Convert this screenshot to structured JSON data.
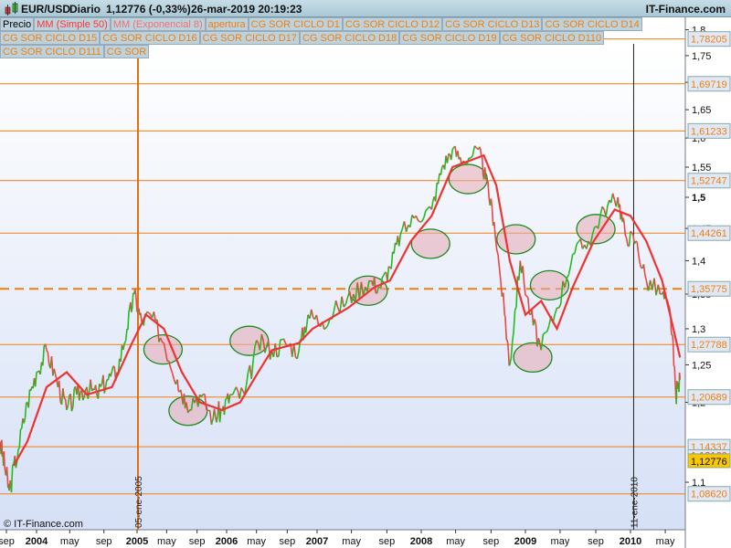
{
  "header": {
    "symbol": "EUR/USD",
    "period": "Diario",
    "price": "1,12776 (-0,33%)",
    "datetime": "26-mar-2019 20:19:23",
    "site": "IT-Finance.com"
  },
  "legend": [
    {
      "label": "Precio",
      "color": "#000000"
    },
    {
      "label": "MM (Simple 50)",
      "color": "#ff3333"
    },
    {
      "label": "MM (Exponencial 8)",
      "color": "#f07070"
    },
    {
      "label": "apertura",
      "color": "#f07f10"
    },
    {
      "label": "CG SOR CICLO D1",
      "color": "#f07f10"
    },
    {
      "label": "CG SOR CICLO D12",
      "color": "#f07f10"
    },
    {
      "label": "CG SOR CICLO D13",
      "color": "#f07f10"
    },
    {
      "label": "CG SOR CICLO D14",
      "color": "#f07f10"
    },
    {
      "label": "CG SOR CICLO D15",
      "color": "#f07f10"
    },
    {
      "label": "CG SOR CICLO D16",
      "color": "#f07f10"
    },
    {
      "label": "CG SOR CICLO D17",
      "color": "#f07f10"
    },
    {
      "label": "CG SOR CICLO D18",
      "color": "#f07f10"
    },
    {
      "label": "CG SOR CICLO D19",
      "color": "#f07f10"
    },
    {
      "label": "CG SOR CICLO D110",
      "color": "#f07f10"
    },
    {
      "label": "CG SOR CICLO D111",
      "color": "#f07f10"
    },
    {
      "label": "CG SOR",
      "color": "#f07f10"
    }
  ],
  "copyright": "© IT-Finance.com",
  "chart_data": {
    "type": "line",
    "yscale": "log",
    "ylim": [
      1.055,
      1.83
    ],
    "xlim": [
      2003.6,
      2010.65
    ],
    "y_ticks": [
      {
        "v": 1.1,
        "l": "1,1"
      },
      {
        "v": 1.2,
        "l": "1,2"
      },
      {
        "v": 1.25,
        "l": "1,25"
      },
      {
        "v": 1.3,
        "l": "1,3"
      },
      {
        "v": 1.35,
        "l": "1,35"
      },
      {
        "v": 1.4,
        "l": "1,4"
      },
      {
        "v": 1.45,
        "l": "1,45"
      },
      {
        "v": 1.5,
        "l": "1,5"
      },
      {
        "v": 1.55,
        "l": "1,55"
      },
      {
        "v": 1.6,
        "l": "1,6"
      },
      {
        "v": 1.65,
        "l": "1,65"
      },
      {
        "v": 1.7,
        "l": "1,7"
      },
      {
        "v": 1.75,
        "l": "1,75"
      },
      {
        "v": 1.8,
        "l": "1,8"
      }
    ],
    "x_ticks": [
      {
        "v": 2003.67,
        "l": "sep"
      },
      {
        "v": 2004.0,
        "l": "2004",
        "bold": true
      },
      {
        "v": 2004.33,
        "l": "may"
      },
      {
        "v": 2004.67,
        "l": "sep"
      },
      {
        "v": 2005.0,
        "l": "2005",
        "bold": true
      },
      {
        "v": 2005.33,
        "l": "may"
      },
      {
        "v": 2005.67,
        "l": "sep"
      },
      {
        "v": 2006.0,
        "l": "2006",
        "bold": true
      },
      {
        "v": 2006.33,
        "l": "may"
      },
      {
        "v": 2006.67,
        "l": "sep"
      },
      {
        "v": 2007.0,
        "l": "2007",
        "bold": true
      },
      {
        "v": 2007.33,
        "l": "may"
      },
      {
        "v": 2007.67,
        "l": "sep"
      },
      {
        "v": 2008.0,
        "l": "2008",
        "bold": true
      },
      {
        "v": 2008.33,
        "l": "may"
      },
      {
        "v": 2008.67,
        "l": "sep"
      },
      {
        "v": 2009.0,
        "l": "2009",
        "bold": true
      },
      {
        "v": 2009.33,
        "l": "may"
      },
      {
        "v": 2009.67,
        "l": "sep"
      },
      {
        "v": 2010.0,
        "l": "2010",
        "bold": true
      },
      {
        "v": 2010.33,
        "l": "may"
      }
    ],
    "price": [
      [
        2003.6,
        1.15
      ],
      [
        2003.65,
        1.12
      ],
      [
        2003.7,
        1.09
      ],
      [
        2003.8,
        1.14
      ],
      [
        2003.9,
        1.2
      ],
      [
        2004.0,
        1.24
      ],
      [
        2004.1,
        1.27
      ],
      [
        2004.2,
        1.23
      ],
      [
        2004.3,
        1.19
      ],
      [
        2004.4,
        1.21
      ],
      [
        2004.5,
        1.22
      ],
      [
        2004.6,
        1.21
      ],
      [
        2004.7,
        1.23
      ],
      [
        2004.8,
        1.24
      ],
      [
        2004.9,
        1.3
      ],
      [
        2004.97,
        1.35
      ],
      [
        2005.05,
        1.31
      ],
      [
        2005.15,
        1.32
      ],
      [
        2005.3,
        1.28
      ],
      [
        2005.45,
        1.23
      ],
      [
        2005.55,
        1.2
      ],
      [
        2005.7,
        1.21
      ],
      [
        2005.85,
        1.18
      ],
      [
        2005.95,
        1.19
      ],
      [
        2006.05,
        1.21
      ],
      [
        2006.2,
        1.21
      ],
      [
        2006.35,
        1.28
      ],
      [
        2006.5,
        1.27
      ],
      [
        2006.65,
        1.28
      ],
      [
        2006.8,
        1.27
      ],
      [
        2006.9,
        1.32
      ],
      [
        2007.05,
        1.31
      ],
      [
        2007.2,
        1.33
      ],
      [
        2007.35,
        1.35
      ],
      [
        2007.5,
        1.37
      ],
      [
        2007.6,
        1.36
      ],
      [
        2007.7,
        1.39
      ],
      [
        2007.8,
        1.44
      ],
      [
        2007.95,
        1.47
      ],
      [
        2008.1,
        1.48
      ],
      [
        2008.2,
        1.55
      ],
      [
        2008.3,
        1.58
      ],
      [
        2008.4,
        1.56
      ],
      [
        2008.55,
        1.58
      ],
      [
        2008.62,
        1.53
      ],
      [
        2008.7,
        1.46
      ],
      [
        2008.8,
        1.32
      ],
      [
        2008.85,
        1.25
      ],
      [
        2008.95,
        1.4
      ],
      [
        2009.05,
        1.32
      ],
      [
        2009.15,
        1.27
      ],
      [
        2009.3,
        1.33
      ],
      [
        2009.45,
        1.41
      ],
      [
        2009.6,
        1.43
      ],
      [
        2009.75,
        1.48
      ],
      [
        2009.88,
        1.5
      ],
      [
        2009.95,
        1.44
      ],
      [
        2010.05,
        1.43
      ],
      [
        2010.15,
        1.37
      ],
      [
        2010.3,
        1.35
      ],
      [
        2010.38,
        1.32
      ],
      [
        2010.43,
        1.21
      ],
      [
        2010.47,
        1.23
      ]
    ],
    "sma50": [
      [
        2003.75,
        1.12
      ],
      [
        2003.9,
        1.15
      ],
      [
        2004.1,
        1.22
      ],
      [
        2004.3,
        1.24
      ],
      [
        2004.5,
        1.21
      ],
      [
        2004.75,
        1.22
      ],
      [
        2004.95,
        1.28
      ],
      [
        2005.1,
        1.32
      ],
      [
        2005.3,
        1.3
      ],
      [
        2005.5,
        1.24
      ],
      [
        2005.7,
        1.2
      ],
      [
        2005.95,
        1.19
      ],
      [
        2006.15,
        1.2
      ],
      [
        2006.35,
        1.24
      ],
      [
        2006.5,
        1.27
      ],
      [
        2006.8,
        1.28
      ],
      [
        2006.95,
        1.3
      ],
      [
        2007.3,
        1.33
      ],
      [
        2007.55,
        1.36
      ],
      [
        2007.7,
        1.37
      ],
      [
        2007.9,
        1.43
      ],
      [
        2008.1,
        1.47
      ],
      [
        2008.3,
        1.55
      ],
      [
        2008.6,
        1.57
      ],
      [
        2008.72,
        1.52
      ],
      [
        2008.85,
        1.4
      ],
      [
        2009.0,
        1.32
      ],
      [
        2009.15,
        1.34
      ],
      [
        2009.3,
        1.3
      ],
      [
        2009.45,
        1.36
      ],
      [
        2009.65,
        1.43
      ],
      [
        2009.85,
        1.48
      ],
      [
        2010.0,
        1.47
      ],
      [
        2010.15,
        1.43
      ],
      [
        2010.3,
        1.37
      ],
      [
        2010.47,
        1.26
      ]
    ],
    "levels": [
      {
        "v": 1.78205,
        "l": "1,78205"
      },
      {
        "v": 1.69719,
        "l": "1,69719"
      },
      {
        "v": 1.61233,
        "l": "1,61233"
      },
      {
        "v": 1.52747,
        "l": "1,52747"
      },
      {
        "v": 1.44261,
        "l": "1,44261"
      },
      {
        "v": 1.35775,
        "l": "1,35775",
        "dashed": true
      },
      {
        "v": 1.27788,
        "l": "1,27788"
      },
      {
        "v": 1.20689,
        "l": "1,20689"
      },
      {
        "v": 1.14337,
        "l": "1,14337"
      },
      {
        "v": 1.0862,
        "l": "1,08620"
      }
    ],
    "sma_last": {
      "v": 1.1316,
      "l": "1,13160"
    },
    "last_price": {
      "v": 1.12776,
      "l": "1,12776"
    },
    "vlines": [
      {
        "v": 2005.01,
        "l": "05-ene-2005",
        "color": "#e07010"
      },
      {
        "v": 2010.03,
        "l": "11-ene-2010",
        "color": "#222222"
      }
    ],
    "cycle_circles": [
      [
        2005.29,
        1.271
      ],
      [
        2005.57,
        1.189
      ],
      [
        2006.25,
        1.283
      ],
      [
        2007.49,
        1.355
      ],
      [
        2008.09,
        1.426
      ],
      [
        2008.45,
        1.53
      ],
      [
        2008.91,
        1.433
      ],
      [
        2009.07,
        1.26
      ],
      [
        2009.23,
        1.363
      ],
      [
        2009.67,
        1.449
      ]
    ]
  }
}
